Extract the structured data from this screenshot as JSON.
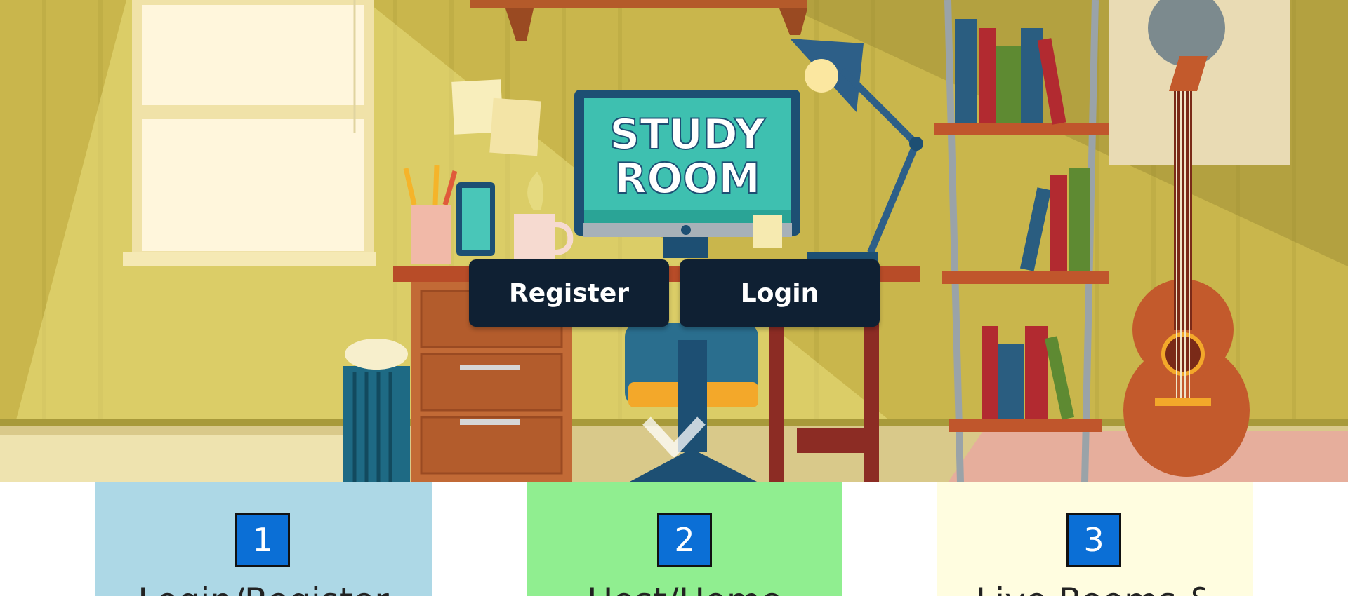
{
  "hero": {
    "image_alt": "Study room illustration",
    "monitor_text_line1": "STUDY",
    "monitor_text_line2": "ROOM",
    "scroll_icon": "chevron-down-icon"
  },
  "auth": {
    "register_label": "Register",
    "login_label": "Login"
  },
  "steps": [
    {
      "number": "1",
      "title": "Login/Register",
      "background": "#add8e6"
    },
    {
      "number": "2",
      "title": "Host/Home",
      "background": "#90ee90"
    },
    {
      "number": "3",
      "title": "Live Rooms &",
      "background": "#fffde0"
    }
  ],
  "colors": {
    "button_bg": "#0f2033",
    "number_badge": "#0b6fd6"
  }
}
